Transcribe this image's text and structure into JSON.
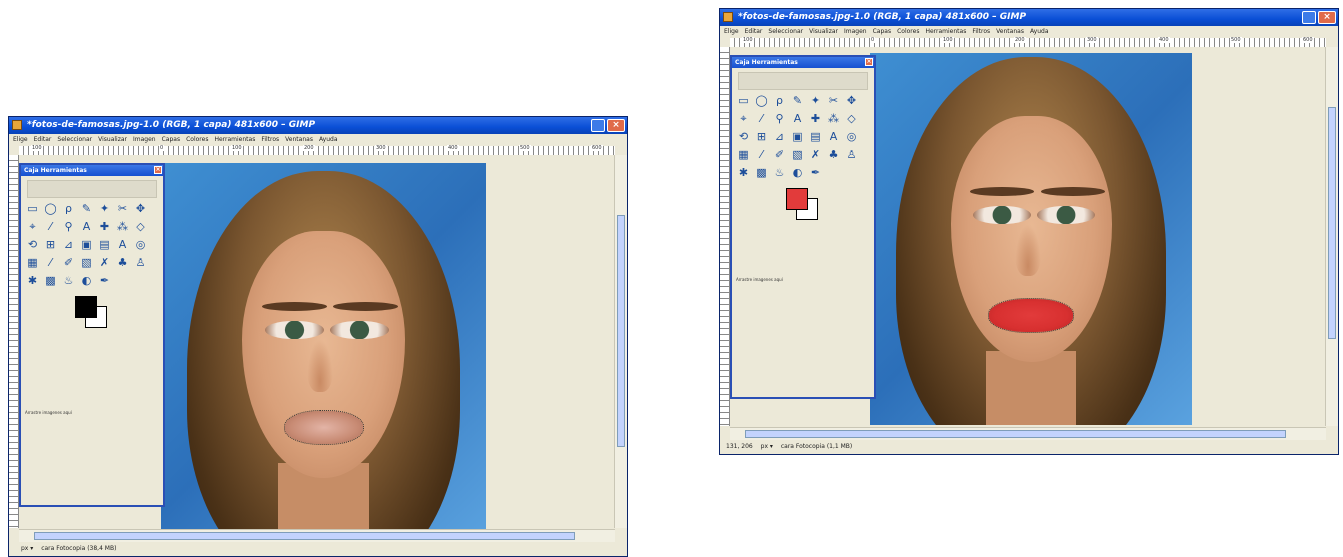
{
  "title": "*fotos-de-famosas.jpg-1.0 (RGB, 1 capa) 481x600 – GIMP",
  "menu": [
    "Elige",
    "Editar",
    "Seleccionar",
    "Visualizar",
    "Imagen",
    "Capas",
    "Colores",
    "Herramientas",
    "Filtros",
    "Ventanas",
    "Ayuda"
  ],
  "ruler_ticks": [
    "100",
    "0",
    "100",
    "200",
    "300",
    "400",
    "500",
    "600"
  ],
  "toolbox_title": "Caja Herramientas",
  "toolbox_hint": "Arrastre imagenes aquí",
  "tools": [
    {
      "glyph": "▭",
      "icon": "rect-select-icon"
    },
    {
      "glyph": "◯",
      "icon": "ellipse-select-icon"
    },
    {
      "glyph": "ρ",
      "icon": "lasso-icon"
    },
    {
      "glyph": "✎",
      "icon": "fuzzy-select-icon"
    },
    {
      "glyph": "✦",
      "icon": "color-select-icon"
    },
    {
      "glyph": "✂",
      "icon": "scissors-icon"
    },
    {
      "glyph": "✥",
      "icon": "foreground-select-icon"
    },
    {
      "glyph": "⌖",
      "icon": "paths-icon"
    },
    {
      "glyph": "⁄",
      "icon": "color-picker-icon"
    },
    {
      "glyph": "⚲",
      "icon": "zoom-icon"
    },
    {
      "glyph": "A",
      "icon": "measure-icon"
    },
    {
      "glyph": "✚",
      "icon": "move-icon"
    },
    {
      "glyph": "⁂",
      "icon": "align-icon"
    },
    {
      "glyph": "◇",
      "icon": "crop-icon"
    },
    {
      "glyph": "⟲",
      "icon": "rotate-icon"
    },
    {
      "glyph": "⊞",
      "icon": "scale-icon"
    },
    {
      "glyph": "⊿",
      "icon": "shear-icon"
    },
    {
      "glyph": "▣",
      "icon": "perspective-icon"
    },
    {
      "glyph": "▤",
      "icon": "flip-icon"
    },
    {
      "glyph": "A",
      "icon": "text-icon"
    },
    {
      "glyph": "◎",
      "icon": "bucket-fill-icon"
    },
    {
      "glyph": "▦",
      "icon": "blend-icon"
    },
    {
      "glyph": "⁄",
      "icon": "pencil-icon"
    },
    {
      "glyph": "✐",
      "icon": "paintbrush-icon"
    },
    {
      "glyph": "▧",
      "icon": "eraser-icon"
    },
    {
      "glyph": "✗",
      "icon": "airbrush-icon"
    },
    {
      "glyph": "♣",
      "icon": "ink-icon"
    },
    {
      "glyph": "♙",
      "icon": "clone-icon"
    },
    {
      "glyph": "✱",
      "icon": "heal-icon"
    },
    {
      "glyph": "▩",
      "icon": "perspective-clone-icon"
    },
    {
      "glyph": "♨",
      "icon": "blur-icon"
    },
    {
      "glyph": "◐",
      "icon": "smudge-icon"
    },
    {
      "glyph": "✒",
      "icon": "dodge-burn-icon"
    }
  ],
  "left_window": {
    "status_coords": "",
    "status_unit": "px ▾",
    "status_info": "cara Fotocopia (38,4 MB)",
    "fg_color": "#000000",
    "lip_color": "#e3b4a6"
  },
  "right_window": {
    "status_coords": "131, 206",
    "status_unit": "px ▾",
    "status_info": "cara Fotocopia (1,1 MB)",
    "fg_color": "#e23b3b",
    "lip_color": "#e23b3b"
  },
  "colors": {
    "titlebar": "#0a4fd6",
    "toolbox_border": "#2a4fb5",
    "window_bg": "#ece9d8",
    "sky": "#3f8fd2"
  }
}
